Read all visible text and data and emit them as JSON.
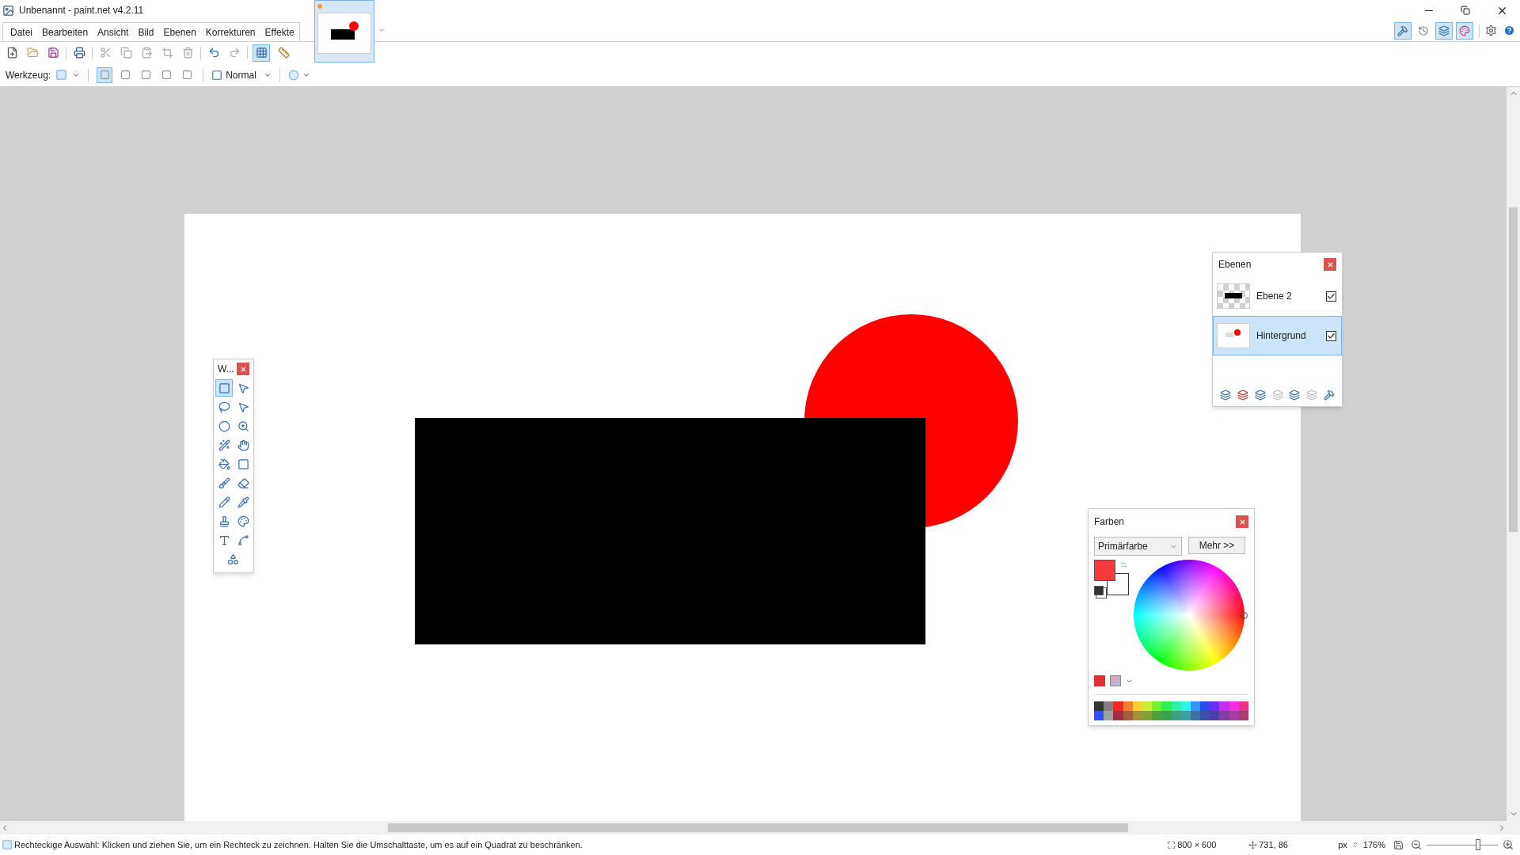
{
  "window": {
    "title": "Unbenannt - paint.net v4.2.11"
  },
  "menu": [
    "Datei",
    "Bearbeiten",
    "Ansicht",
    "Bild",
    "Ebenen",
    "Korrekturen",
    "Effekte"
  ],
  "document_tab": {
    "selected": true,
    "modified": true
  },
  "toolbar": {
    "grid": {
      "selected": true
    },
    "rulers": {
      "selected": false
    }
  },
  "window_toggles": [
    {
      "selected": true
    },
    {
      "selected": false
    },
    {
      "selected": true
    },
    {
      "selected": true
    }
  ],
  "tool_options": {
    "label": "Werkzeug:",
    "selection_modes": [
      {
        "selected": true
      },
      {
        "selected": false
      },
      {
        "selected": false
      },
      {
        "selected": false
      },
      {
        "selected": false
      }
    ],
    "blend_mode": "Normal"
  },
  "tools_window": {
    "title": "W...",
    "tools": [
      {
        "selected": true
      },
      {
        "selected": false
      },
      {
        "selected": false
      },
      {
        "selected": false
      },
      {
        "selected": false
      },
      {
        "selected": false
      },
      {
        "selected": false
      },
      {
        "selected": false
      },
      {
        "selected": false
      },
      {
        "selected": false
      },
      {
        "selected": false
      },
      {
        "selected": false
      },
      {
        "selected": false
      },
      {
        "selected": false
      },
      {
        "selected": false
      },
      {
        "selected": false
      },
      {
        "selected": false
      },
      {
        "selected": false
      },
      {
        "selected": false
      }
    ]
  },
  "layers_window": {
    "title": "Ebenen",
    "layers": [
      {
        "name": "Ebene 2",
        "visible": true,
        "selected": false
      },
      {
        "name": "Hintergrund",
        "visible": true,
        "selected": true
      }
    ]
  },
  "colors_window": {
    "title": "Farben",
    "dropdown": "Primärfarbe",
    "more_button": "Mehr >>",
    "swatches": [
      {
        "kind": "primary",
        "color": "#f93a3a"
      },
      {
        "kind": "secondary",
        "color": "#ffffff"
      }
    ],
    "palette": [
      {
        "color": "#333333"
      },
      {
        "color": "#808080"
      },
      {
        "color": "#f02828"
      },
      {
        "color": "#f08030"
      },
      {
        "color": "#f8d030"
      },
      {
        "color": "#c8f030"
      },
      {
        "color": "#70f030"
      },
      {
        "color": "#30f050"
      },
      {
        "color": "#30f0a8"
      },
      {
        "color": "#30f0f0"
      },
      {
        "color": "#3098f0"
      },
      {
        "color": "#3048f0"
      },
      {
        "color": "#6830f0"
      },
      {
        "color": "#c030f0"
      },
      {
        "color": "#f030e0"
      },
      {
        "color": "#f03088"
      },
      {
        "color": "#3050f0"
      },
      {
        "color": "#a0a0a0"
      },
      {
        "color": "#a03040"
      },
      {
        "color": "#a06040"
      },
      {
        "color": "#a09040"
      },
      {
        "color": "#80a040"
      },
      {
        "color": "#50a040"
      },
      {
        "color": "#40a050"
      },
      {
        "color": "#40a080"
      },
      {
        "color": "#40a0a0"
      },
      {
        "color": "#4070a0"
      },
      {
        "color": "#4050a0"
      },
      {
        "color": "#5040a0"
      },
      {
        "color": "#8040a0"
      },
      {
        "color": "#a040a0"
      },
      {
        "color": "#a04070"
      }
    ]
  },
  "status_bar": {
    "hint": "Rechteckige Auswahl: Klicken und ziehen Sie, um ein Rechteck zu zeichnen. Halten Sie die Umschalttaste, um es auf ein Quadrat zu beschränken.",
    "image_size": "800 × 600",
    "cursor": "731, 86",
    "unit": "px",
    "zoom": "176%",
    "zoom_slider": {
      "level": 0.72
    }
  }
}
